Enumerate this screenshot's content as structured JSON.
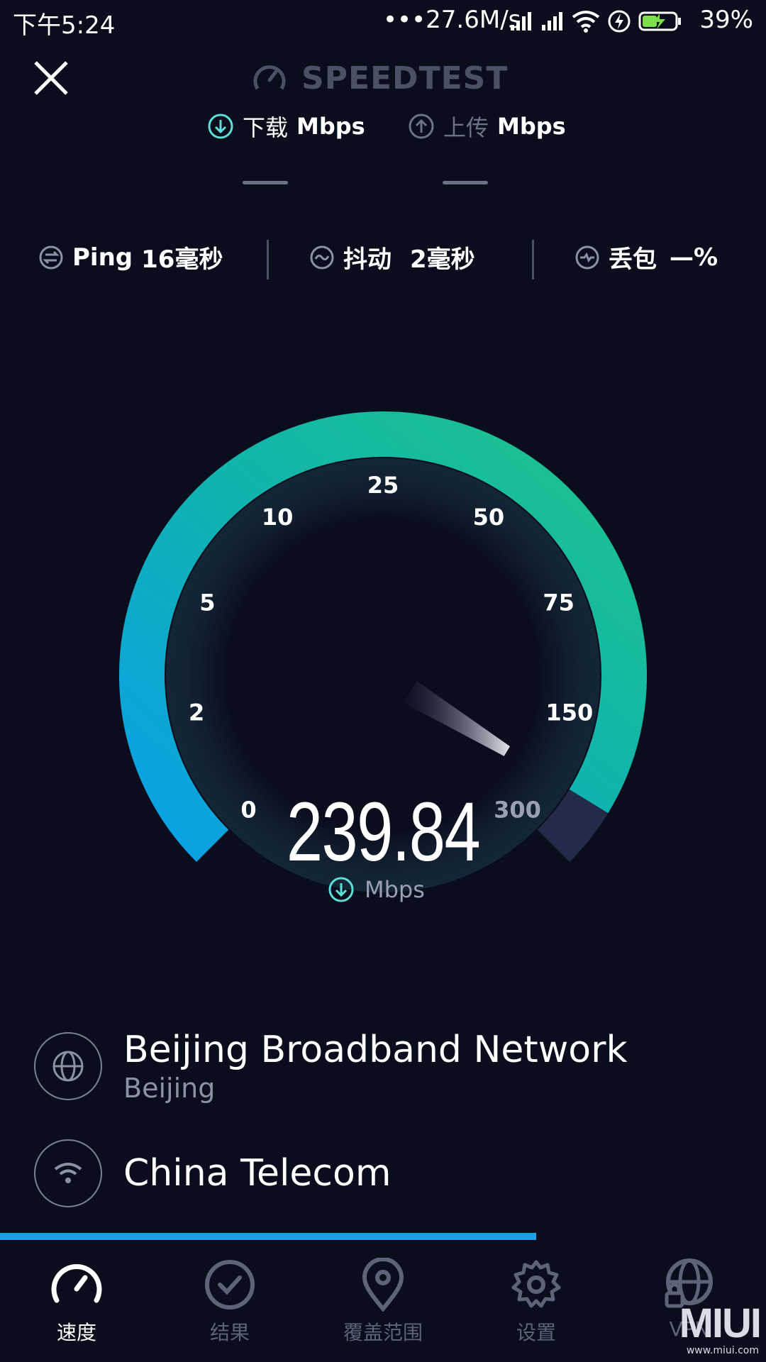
{
  "status_bar": {
    "time": "下午5:24",
    "net_speed": "•••27.6M/s",
    "battery": "39%"
  },
  "header": {
    "brand": "SPEEDTEST",
    "download_label": "下载",
    "upload_label": "上传",
    "unit": "Mbps"
  },
  "stats": {
    "ping_label": "Ping",
    "ping_value": "16毫秒",
    "jitter_label": "抖动",
    "jitter_value": "2毫秒",
    "loss_label": "丢包",
    "loss_value": "—%"
  },
  "gauge": {
    "ticks": [
      "0",
      "2",
      "5",
      "10",
      "25",
      "50",
      "75",
      "150",
      "300"
    ],
    "current_speed": "239.84",
    "unit": "Mbps",
    "scale_max": 300,
    "value": 239.84
  },
  "server": {
    "isp_name": "Beijing Broadband Network",
    "isp_location": "Beijing",
    "carrier": "China Telecom"
  },
  "progress": {
    "fraction": 0.7
  },
  "nav": {
    "items": [
      {
        "label": "速度",
        "icon": "speedometer-icon",
        "active": true
      },
      {
        "label": "结果",
        "icon": "check-circle-icon",
        "active": false
      },
      {
        "label": "覆盖范围",
        "icon": "location-pin-icon",
        "active": false
      },
      {
        "label": "设置",
        "icon": "gear-icon",
        "active": false
      },
      {
        "label": "VPN",
        "icon": "globe-lock-icon",
        "active": false
      }
    ]
  },
  "watermark": {
    "brand": "MIUI",
    "url": "www.miui.com"
  },
  "colors": {
    "background": "#0a0d1c",
    "accent_cyan": "#5ee0d8",
    "gauge_start": "#0aa0e8",
    "gauge_end": "#1ec48a",
    "progress": "#1aa3e8"
  }
}
